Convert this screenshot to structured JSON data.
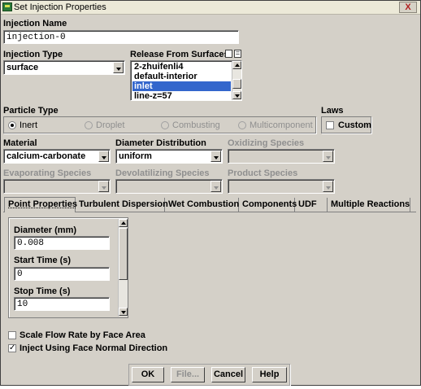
{
  "window": {
    "title": "Set Injection Properties",
    "close_glyph": "X"
  },
  "injection_name": {
    "label": "Injection Name",
    "value": "injection-0"
  },
  "injection_type": {
    "label": "Injection Type",
    "value": "surface"
  },
  "release_surfaces": {
    "label": "Release From Surfaces",
    "items": [
      "2-zhuifenli4",
      "default-interior",
      "inlet",
      "line-z=57"
    ],
    "selected": "inlet"
  },
  "particle_type": {
    "label": "Particle Type",
    "options": [
      "Inert",
      "Droplet",
      "Combusting",
      "Multicomponent"
    ],
    "selected": "Inert"
  },
  "laws": {
    "label": "Laws",
    "custom_label": "Custom"
  },
  "material": {
    "label": "Material",
    "value": "calcium-carbonate"
  },
  "diameter_distribution": {
    "label": "Diameter Distribution",
    "value": "uniform"
  },
  "oxidizing_species": {
    "label": "Oxidizing Species"
  },
  "evaporating_species": {
    "label": "Evaporating Species"
  },
  "devolatilizing_species": {
    "label": "Devolatilizing Species"
  },
  "product_species": {
    "label": "Product Species"
  },
  "tabs": [
    "Point Properties",
    "Turbulent Dispersion",
    "Wet Combustion",
    "Components",
    "UDF",
    "Multiple Reactions"
  ],
  "point_properties": {
    "diameter": {
      "label": "Diameter (mm)",
      "value": "0.008"
    },
    "start_time": {
      "label": "Start Time (s)",
      "value": "0"
    },
    "stop_time": {
      "label": "Stop Time (s)",
      "value": "10"
    }
  },
  "options": {
    "scale_flow_rate": {
      "label": "Scale Flow Rate by Face Area",
      "checked": false
    },
    "inject_normal": {
      "label": "Inject Using Face Normal Direction",
      "checked": true
    }
  },
  "buttons": {
    "ok": "OK",
    "file": "File...",
    "cancel": "Cancel",
    "help": "Help"
  }
}
